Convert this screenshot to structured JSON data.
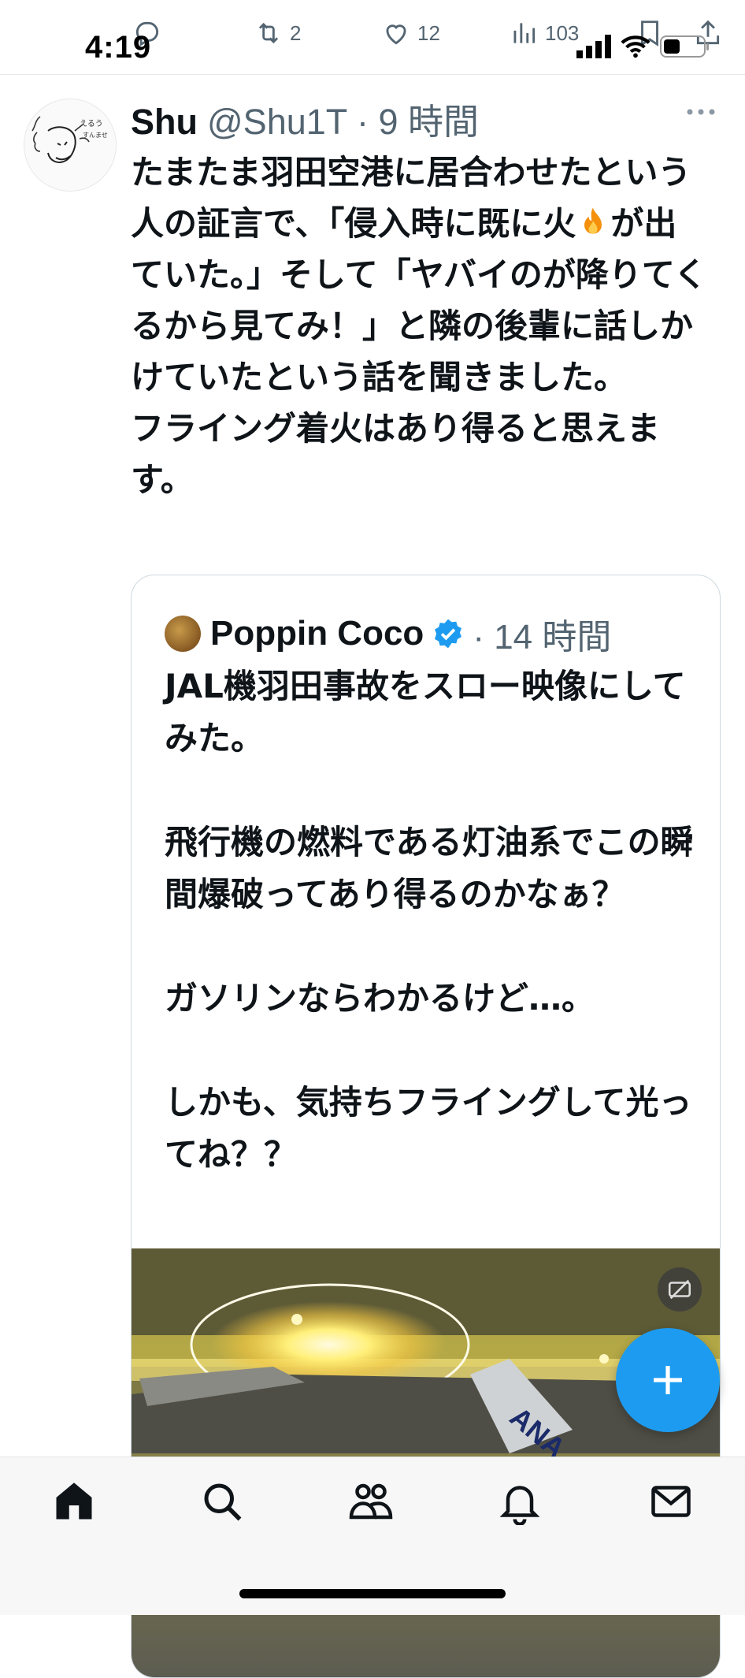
{
  "status_bar": {
    "time": "4:19"
  },
  "actions": {
    "reply_icon": "reply-icon",
    "retweet_count": "2",
    "like_count": "12",
    "views_count": "103"
  },
  "tweet": {
    "author_name": "Shu",
    "handle_time": "@Shu1T · 9 時間",
    "text_before_emoji": "たまたま羽田空港に居合わせたという人の証言で、「侵入時に既に火",
    "text_after_emoji": "が出ていた。」そして「ヤバイのが降りてくるから見てみ！」と隣の後輩に話しかけていたという話を聞きました。\nフライング着火はあり得ると思えます。",
    "emoji": "fire-emoji"
  },
  "quoted_tweet": {
    "author_name": "Poppin Coco",
    "verified": true,
    "time": "· 14 時間",
    "text": "JAL機羽田事故をスロー映像にしてみた。\n\n飛行機の燃料である灯油系でこの瞬間爆破ってあり得るのかなぁ？\n\nガソリンならわかるけど…。\n\nしかも、気持ちフライングして光ってね？？",
    "media_badge": "captions-off-icon"
  },
  "colors": {
    "accent": "#1d9bf0",
    "muted_text": "#536471",
    "text": "#0f1419"
  },
  "bottom_nav": [
    "home-icon",
    "search-icon",
    "communities-icon",
    "notifications-icon",
    "messages-icon"
  ]
}
